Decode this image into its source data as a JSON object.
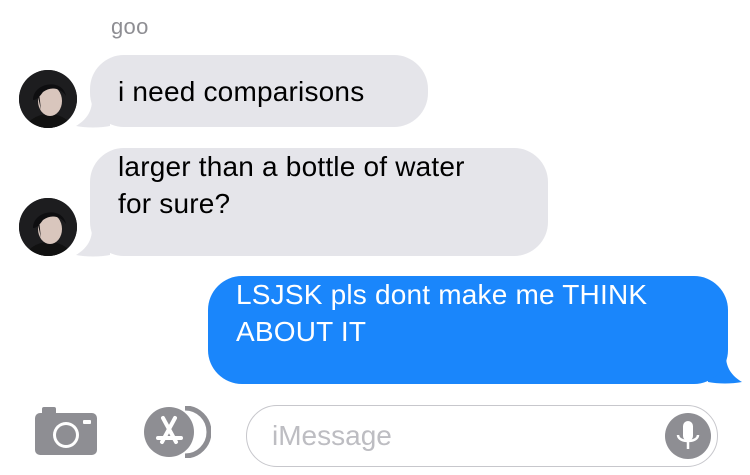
{
  "conversation": {
    "sender_name": "goo",
    "messages": [
      {
        "direction": "incoming",
        "text": "i need comparisons"
      },
      {
        "direction": "incoming",
        "lines": [
          "larger than a bottle of water",
          "for sure?"
        ]
      },
      {
        "direction": "outgoing",
        "lines": [
          "LSJSK pls dont make me THINK",
          "ABOUT IT"
        ]
      }
    ]
  },
  "input_bar": {
    "camera_icon": "camera-icon",
    "apps_icon": "app-store-icon",
    "message_placeholder": "iMessage",
    "mic_icon": "microphone-icon"
  },
  "colors": {
    "incoming_bubble": "#e5e5ea",
    "outgoing_bubble": "#1a86fb",
    "icon_gray": "#8e8e93"
  }
}
